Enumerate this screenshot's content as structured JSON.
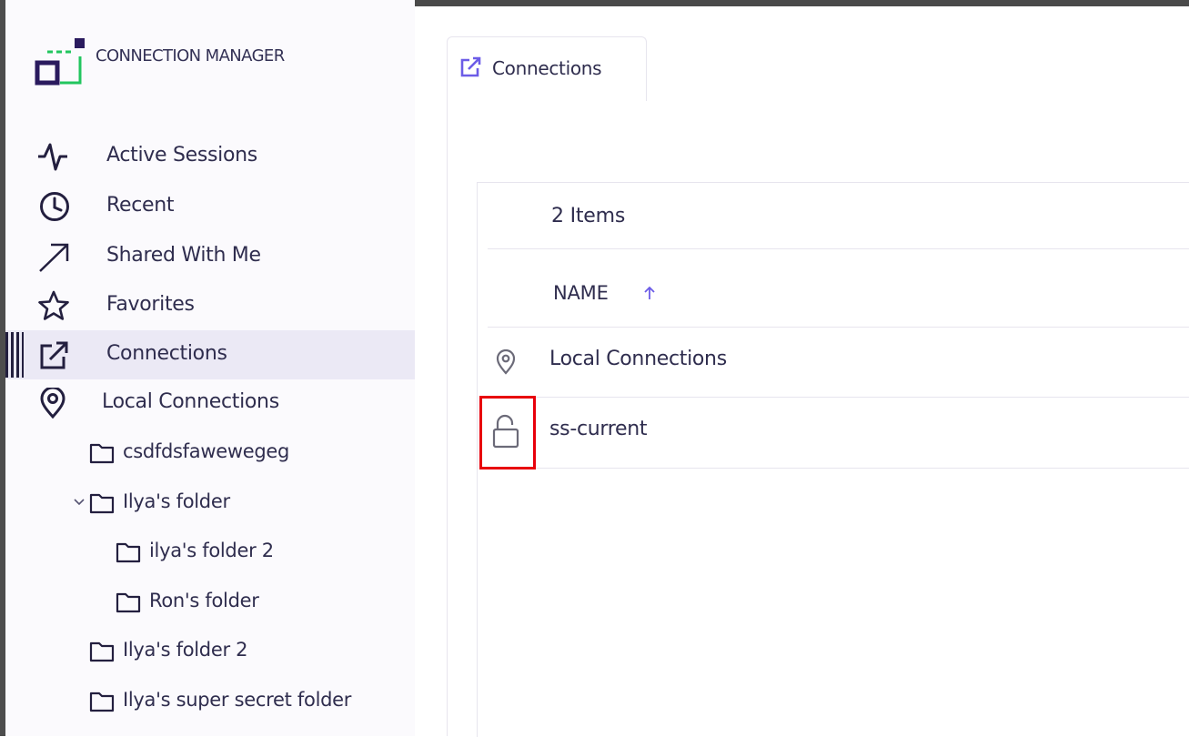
{
  "app": {
    "brand": "CONNECTION MANAGER"
  },
  "colors": {
    "accent": "#6c5ce7",
    "logo_green": "#22c55e",
    "logo_navy": "#2a1a5e",
    "active_bg": "#ebe9f5",
    "highlight": "#e8000b"
  },
  "sidebar": {
    "nav": [
      {
        "label": "Active Sessions",
        "icon": "pulse-icon"
      },
      {
        "label": "Recent",
        "icon": "clock-icon"
      },
      {
        "label": "Shared With Me",
        "icon": "arrow-up-right-icon"
      },
      {
        "label": "Favorites",
        "icon": "star-icon"
      },
      {
        "label": "Connections",
        "icon": "external-link-icon",
        "active": true
      }
    ],
    "local": {
      "label": "Local Connections",
      "icon": "map-pin-icon"
    },
    "tree": [
      {
        "label": "csdfdsfawewegeg",
        "level": 1
      },
      {
        "label": "Ilya's folder",
        "level": 1,
        "expanded": true
      },
      {
        "label": "ilya's folder 2",
        "level": 2
      },
      {
        "label": "Ron's folder",
        "level": 2
      },
      {
        "label": "Ilya's folder 2",
        "level": 1
      },
      {
        "label": "Ilya's super secret folder",
        "level": 1
      }
    ]
  },
  "tab": {
    "label": "Connections",
    "icon": "external-link-icon"
  },
  "list": {
    "count_label": "2 Items",
    "column": "NAME",
    "sort": "ascending",
    "rows": [
      {
        "label": "Local Connections",
        "icon": "map-pin-icon"
      },
      {
        "label": "ss-current",
        "icon": "unlock-icon"
      }
    ]
  }
}
